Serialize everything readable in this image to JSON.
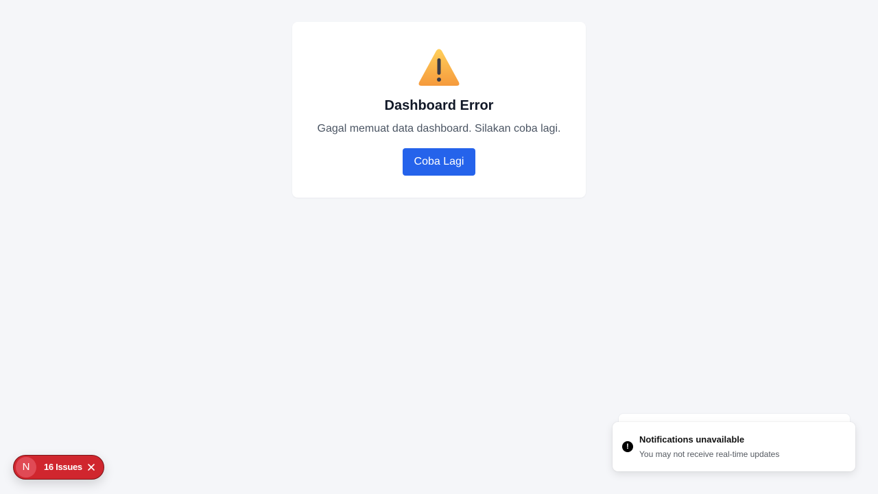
{
  "error": {
    "icon": "warning-icon",
    "title": "Dashboard Error",
    "message": "Gagal memuat data dashboard. Silakan coba lagi.",
    "retry_label": "Coba Lagi"
  },
  "toast": {
    "icon": "alert-icon",
    "title": "Notifications unavailable",
    "description": "You may not receive real-time updates"
  },
  "dev_indicator": {
    "logo_letter": "N",
    "issues_label": "16 Issues",
    "close_icon": "close-icon"
  },
  "colors": {
    "background": "#f5f6f9",
    "primary": "#2563eb",
    "error_pill": "#d0262e",
    "warning": "#f5a623"
  }
}
